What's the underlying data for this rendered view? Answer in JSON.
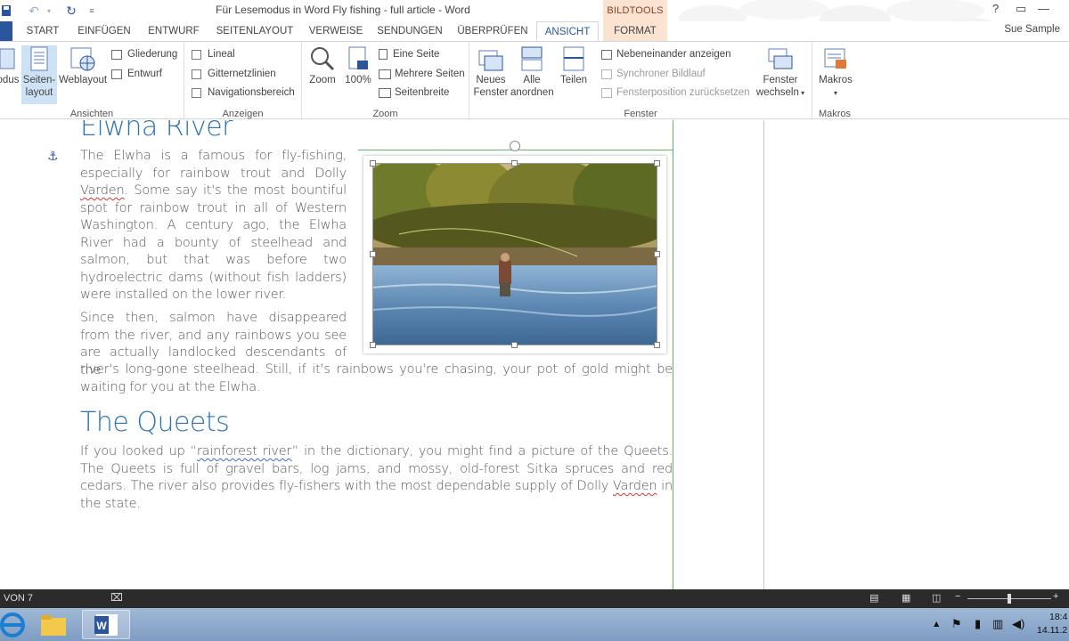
{
  "window": {
    "title": "Für Lesemodus in Word Fly fishing - full article - Word",
    "context_tab_group": "BILDTOOLS",
    "controls": [
      "?",
      "▭",
      "—"
    ]
  },
  "tabs": [
    {
      "label": "START"
    },
    {
      "label": "EINFÜGEN"
    },
    {
      "label": "ENTWURF"
    },
    {
      "label": "SEITENLAYOUT"
    },
    {
      "label": "VERWEISE"
    },
    {
      "label": "SENDUNGEN"
    },
    {
      "label": "ÜBERPRÜFEN"
    },
    {
      "label": "ANSICHT"
    },
    {
      "label": "FORMAT"
    }
  ],
  "user": "Sue Sample",
  "ribbon": {
    "ansichten": {
      "label": "Ansichten",
      "lesemodus": "odus",
      "seitenlayout_1": "Seiten-",
      "seitenlayout_2": "layout",
      "weblayout": "Weblayout",
      "gliederung": "Gliederung",
      "entwurf": "Entwurf"
    },
    "anzeigen": {
      "label": "Anzeigen",
      "lineal": "Lineal",
      "gitternetzlinien": "Gitternetzlinien",
      "navigationsbereich": "Navigationsbereich"
    },
    "zoom": {
      "label": "Zoom",
      "zoom": "Zoom",
      "hundred": "100%",
      "eine_seite": "Eine Seite",
      "mehrere_seiten": "Mehrere Seiten",
      "seitenbreite": "Seitenbreite"
    },
    "fenster": {
      "label": "Fenster",
      "neues_1": "Neues",
      "neues_2": "Fenster",
      "alle_1": "Alle",
      "alle_2": "anordnen",
      "teilen": "Teilen",
      "nebeneinander": "Nebeneinander anzeigen",
      "synchroner": "Synchroner Bildlauf",
      "fensterposition": "Fensterposition zurücksetzen",
      "wechseln_1": "Fenster",
      "wechseln_2": "wechseln"
    },
    "makros": {
      "label": "Makros",
      "makros": "Makros"
    }
  },
  "document": {
    "heading1": "Elwha River",
    "para1_a": "The Elwha is a famous for fly-fishing, especially for rainbow trout and Dolly ",
    "para1_varden": "Varden",
    "para1_b": ". Some say it's the most bountiful spot for rainbow trout in all of Western Washington. A century ago, the Elwha River had a bounty of steelhead and salmon, but that was before two hydroelectric dams (without fish ladders) were installed on the lower river.",
    "para2_a": "Since then, salmon have disappeared from the river, and any rainbows you see are actually landlocked descendants of the",
    "para2_b": "river's long-gone steelhead. Still, if it's rainbows you're chasing, your pot of gold might be waiting for you at the Elwha.",
    "heading2": "The Queets",
    "para3_a": "If you looked up “",
    "para3_link": "rainforest river",
    "para3_b": "” in the dictionary, you might find a picture of the Queets. The Queets is full of gravel bars, log jams, and mossy, old-forest Sitka spruces and red cedars. The river also provides fly-fishers with the most dependable supply of Dolly ",
    "para3_varden": "Varden",
    "para3_c": " in the state."
  },
  "statusbar": {
    "page": "VON 7"
  },
  "taskbar": {
    "time": "18:4",
    "date": "14.11.2"
  },
  "colors": {
    "word_blue": "#2b579a",
    "heading_blue": "#2e74b5",
    "format_tab_bg": "#fbe3d2",
    "status_bar": "#2b2b2b"
  }
}
